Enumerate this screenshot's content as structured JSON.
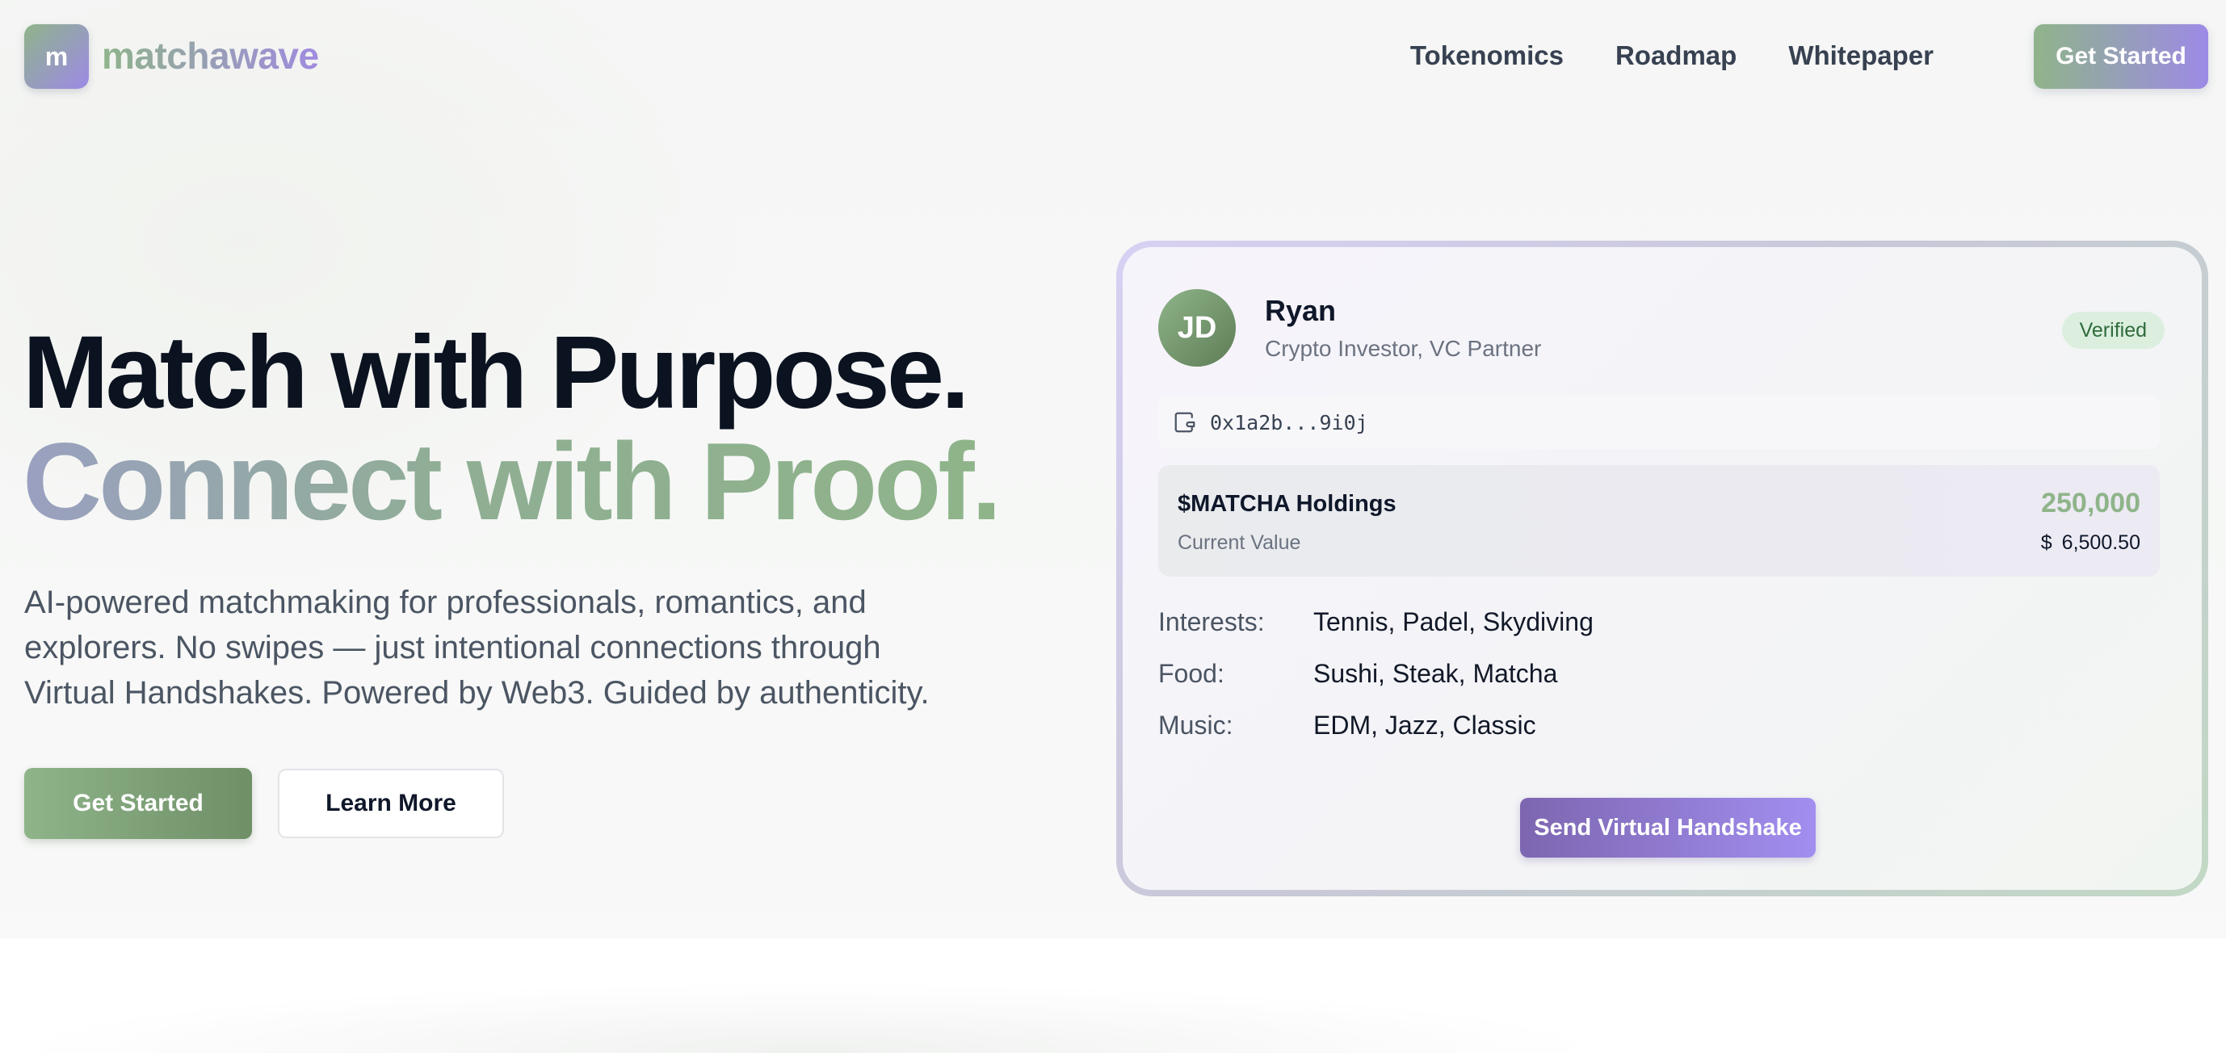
{
  "brand": {
    "logo_letter": "m",
    "name": "matchawave"
  },
  "nav": {
    "links": [
      "Tokenomics",
      "Roadmap",
      "Whitepaper"
    ],
    "cta_label": "Get Started"
  },
  "hero": {
    "title_line1": "Match with Purpose.",
    "title_line2": "Connect with Proof.",
    "subtitle": "AI-powered matchmaking for professionals, romantics, and explorers. No swipes — just intentional connections through Virtual Handshakes. Powered by Web3. Guided by authenticity.",
    "primary_button": "Get Started",
    "secondary_button": "Learn More"
  },
  "profile_card": {
    "avatar_initials": "JD",
    "name": "Ryan",
    "role": "Crypto Investor, VC Partner",
    "badge": "Verified",
    "wallet_icon": "wallet-icon",
    "wallet_address": "0x1a2b...9i0j",
    "holdings": {
      "title": "$MATCHA Holdings",
      "subtitle": "Current Value",
      "amount": "250,000",
      "currency": "$",
      "value": "6,500.50"
    },
    "properties": [
      {
        "key": "Interests:",
        "value": "Tennis, Padel, Skydiving"
      },
      {
        "key": "Food:",
        "value": "Sushi, Steak, Matcha"
      },
      {
        "key": "Music:",
        "value": "EDM, Jazz, Classic"
      }
    ],
    "action_button": "Send Virtual Handshake"
  },
  "colors": {
    "accent_green": "#8fb48a",
    "accent_purple": "#9d8ae6",
    "verified_bg": "#dcefdf",
    "verified_text": "#2f6b3b"
  }
}
